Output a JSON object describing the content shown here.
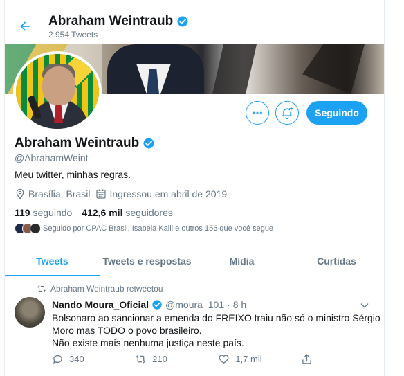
{
  "header": {
    "name": "Abraham Weintraub",
    "tweet_count": "2.954 Tweets"
  },
  "actions": {
    "follow_label": "Seguindo"
  },
  "profile": {
    "name": "Abraham Weintraub",
    "handle": "@AbrahamWeint",
    "bio": "Meu twitter, minhas regras.",
    "location": "Brasília, Brasil",
    "joined": "Ingressou em abril de 2019",
    "following_count": "119",
    "following_label": "seguindo",
    "followers_count": "412,6 mil",
    "followers_label": "seguidores",
    "followed_by": "Seguido por CPAC Brasil, Isabela Kalil e outros 156 que você segue"
  },
  "tabs": [
    {
      "label": "Tweets",
      "active": true
    },
    {
      "label": "Tweets e respostas",
      "active": false
    },
    {
      "label": "Mídia",
      "active": false
    },
    {
      "label": "Curtidas",
      "active": false
    }
  ],
  "tweet": {
    "retweet_notice": "Abraham Weintraub retweetou",
    "author_name": "Nando Moura_Oficial",
    "author_handle": "@moura_101",
    "separator": "·",
    "time": "8 h",
    "lines": [
      "Bolsonaro ao sancionar a emenda do FREIXO traiu não só o ministro Sérgio",
      "Moro mas TODO o povo brasileiro.",
      "Não existe mais nenhuma justiça neste país."
    ],
    "replies": "340",
    "retweets": "210",
    "likes": "1,7 mil"
  },
  "colors": {
    "accent": "#1da1f2",
    "muted": "#657786",
    "text": "#14171a"
  }
}
